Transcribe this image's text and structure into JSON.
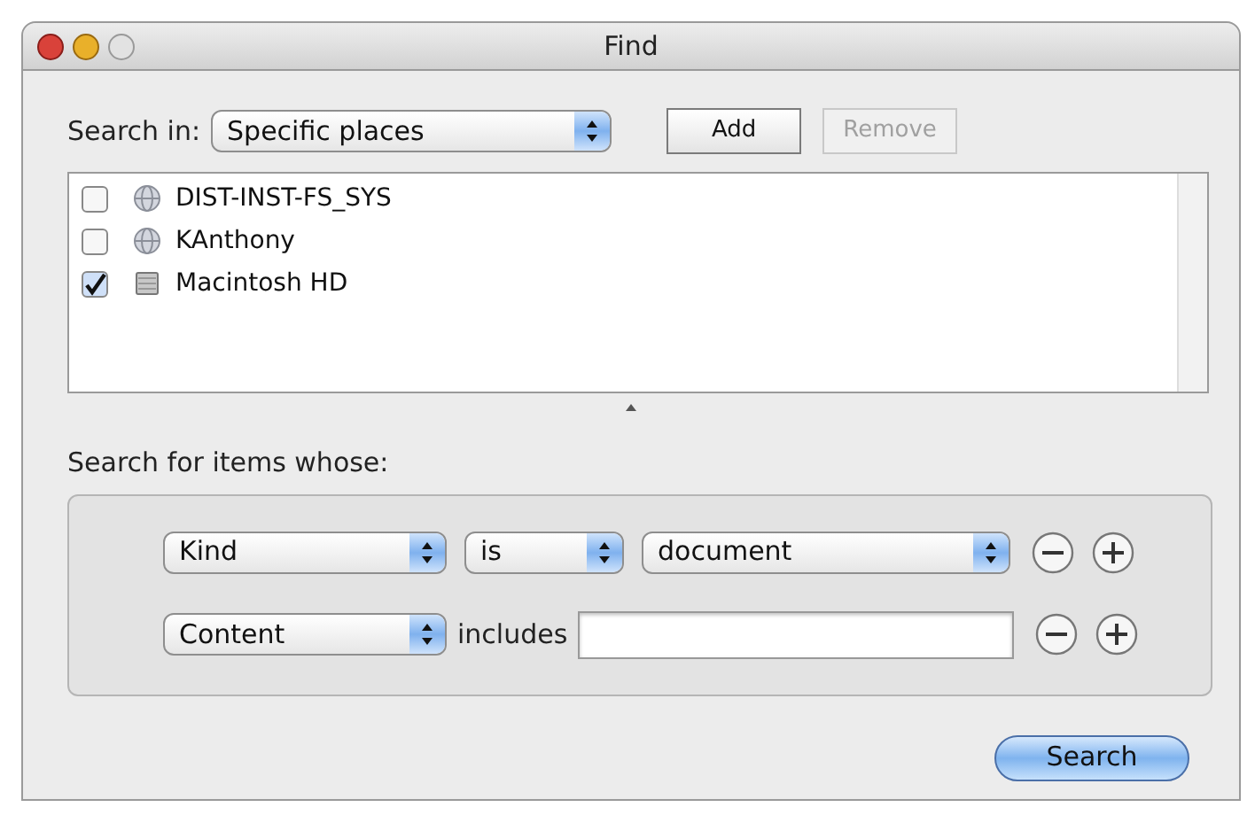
{
  "window": {
    "title": "Find"
  },
  "search_in": {
    "label": "Search in:",
    "value": "Specific places"
  },
  "buttons": [
    {
      "label": "Add",
      "disabled": false
    },
    {
      "label": "Remove",
      "disabled": true
    }
  ],
  "places": [
    {
      "name": "DIST-INST-FS_SYS",
      "checked": false,
      "kind": "network"
    },
    {
      "name": "KAnthony",
      "checked": false,
      "kind": "network"
    },
    {
      "name": "Macintosh HD",
      "checked": true,
      "kind": "disk"
    }
  ],
  "criteria_label": "Search for items whose:",
  "criteria": [
    {
      "parts": [
        {
          "kind": "popup",
          "value": "Kind"
        },
        {
          "kind": "popup",
          "value": "is"
        },
        {
          "kind": "popup",
          "value": "document"
        }
      ]
    },
    {
      "parts": [
        {
          "kind": "popup",
          "value": "Content"
        },
        {
          "kind": "label",
          "text": "includes"
        },
        {
          "kind": "field"
        }
      ]
    }
  ],
  "search_button": "Search"
}
